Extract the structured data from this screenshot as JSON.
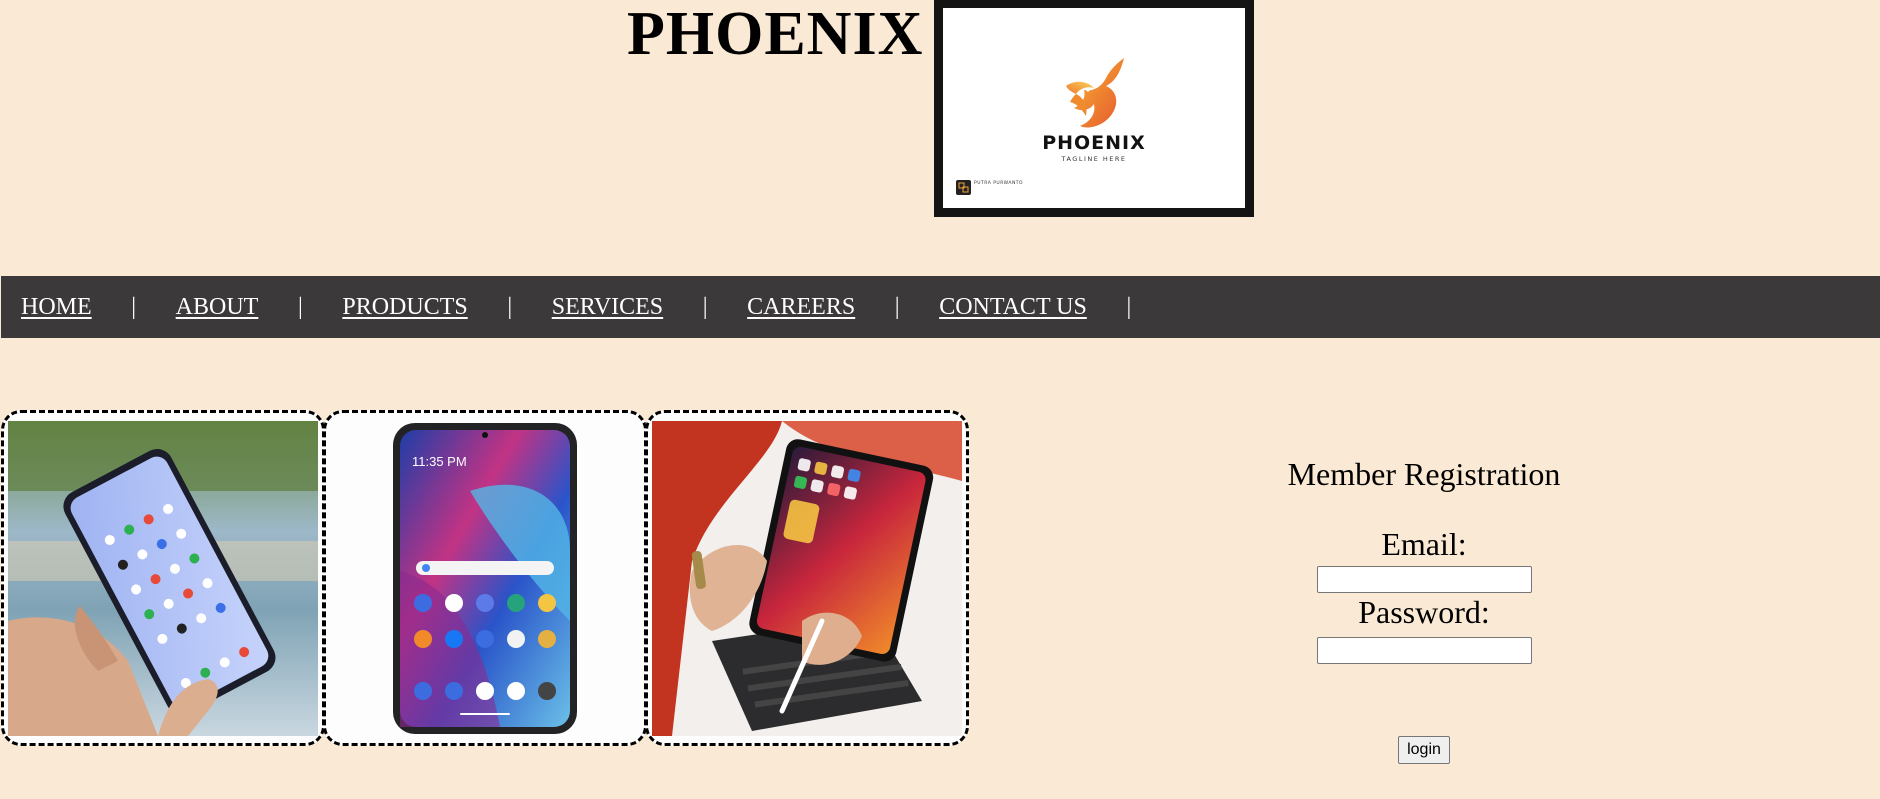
{
  "header": {
    "site_title": "PHOENIX",
    "logo": {
      "name": "PHOENIX",
      "tagline": "TAGLINE HERE",
      "credit": "PUTRA PURWANTO",
      "icon": "phoenix-bird-icon"
    }
  },
  "nav": {
    "items": [
      {
        "label": "HOME"
      },
      {
        "label": "ABOUT"
      },
      {
        "label": "PRODUCTS"
      },
      {
        "label": "SERVICES"
      },
      {
        "label": "CAREERS"
      },
      {
        "label": "CONTACT US"
      }
    ],
    "separator": "|"
  },
  "gallery": {
    "products": [
      {
        "type": "android-phone-in-hand-photo"
      },
      {
        "type": "android-phone-front-photo",
        "phone_time": "11:35 PM"
      },
      {
        "type": "ipad-with-keyboard-photo"
      }
    ]
  },
  "registration": {
    "title": "Member Registration",
    "email_label": "Email:",
    "email_value": "",
    "password_label": "Password:",
    "password_value": "",
    "login_label": "login"
  },
  "colors": {
    "page_background": "#fae9d4",
    "nav_background": "#3b393a",
    "nav_text": "#ffffff"
  }
}
